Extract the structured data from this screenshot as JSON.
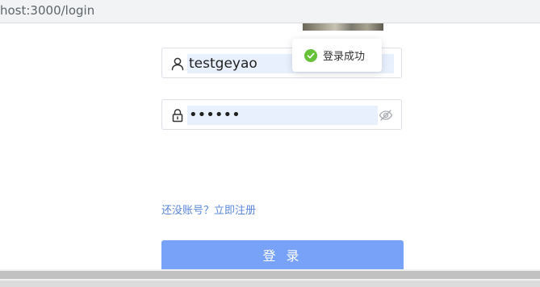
{
  "browser": {
    "url": "host:3000/login"
  },
  "login_form": {
    "username_value": "testgeyao",
    "password_value": "••••••",
    "register_link": "还没账号？立即注册",
    "login_button": "登 录"
  },
  "toast": {
    "message": "登录成功",
    "type": "success"
  },
  "colors": {
    "primary": "#78a2f8",
    "link": "#5b86d8",
    "success": "#67c23a",
    "autofill": "#e8f0fe"
  }
}
